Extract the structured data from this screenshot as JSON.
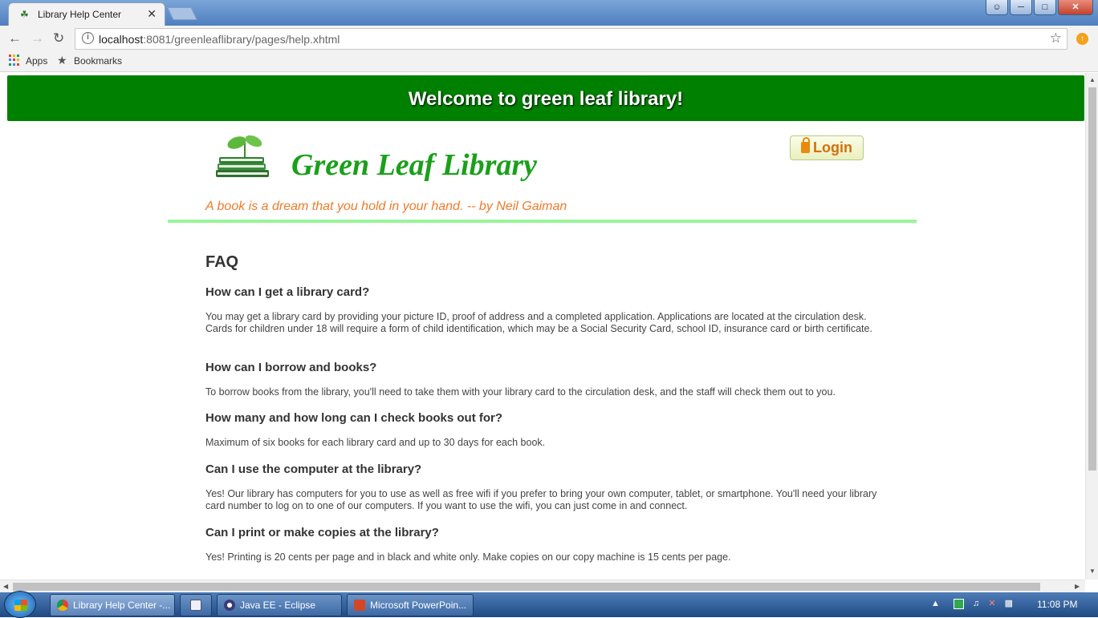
{
  "browser": {
    "tab_title": "Library Help Center",
    "url_host": "localhost",
    "url_path": ":8081/greenleaflibrary/pages/help.xhtml"
  },
  "bookmarks_bar": {
    "apps_label": "Apps",
    "bookmarks_label": "Bookmarks"
  },
  "page": {
    "banner": "Welcome to green leaf library!",
    "brand": "Green Leaf Library",
    "login_label": "Login",
    "quote": "A book is a dream that you hold in your hand. -- by Neil Gaiman",
    "faq_title": "FAQ",
    "faq": [
      {
        "q": "How can I get a library card?",
        "a": "You may get a library card by providing your picture ID, proof of address and a completed application. Applications are located at the circulation desk. Cards for children under 18 will require a form of child identification, which may be a Social Security Card, school ID, insurance card or birth certificate."
      },
      {
        "q": "How can I borrow and books?",
        "a": "To borrow books from the library, you'll need to take them with your library card to the circulation desk, and the staff will check them out to you."
      },
      {
        "q": "How many and how long can I check books out for?",
        "a": "Maximum of six books for each library card and up to 30 days for each book."
      },
      {
        "q": "Can I use the computer at the library?",
        "a": "Yes! Our library has computers for you to use as well as free wifi if you prefer to bring your own computer, tablet, or smartphone. You'll need your library card number to log on to one of our computers. If you want to use the wifi, you can just come in and connect."
      },
      {
        "q": "Can I print or make copies at the library?",
        "a": "Yes! Printing is 20 cents per page and in black and white only. Make copies on our copy machine is 15 cents per page."
      }
    ]
  },
  "taskbar": {
    "items": [
      {
        "label": "Library Help Center -...",
        "icon": "chrome-icon"
      },
      {
        "label": "",
        "icon": "calculator-icon"
      },
      {
        "label": "Java EE - Eclipse",
        "icon": "eclipse-icon"
      },
      {
        "label": "Microsoft PowerPoin...",
        "icon": "powerpoint-icon"
      }
    ],
    "clock": "11:08 PM"
  },
  "colors": {
    "banner_green": "#008000",
    "brand_green": "#1aa01a",
    "quote_orange": "#f07a2a",
    "divider_green": "#98f598"
  }
}
